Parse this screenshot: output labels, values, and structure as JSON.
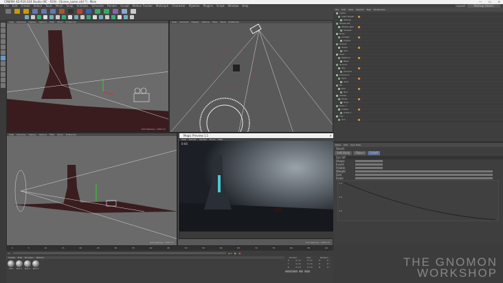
{
  "window": {
    "title": "CINEMA 4D R19.024 Studio (RC - R19) - [Scene_name.c4d *] - Main",
    "layout_label": "Layout:",
    "layout_value": "Startup (User)"
  },
  "menu": [
    "File",
    "Edit",
    "Create",
    "Select",
    "Tools",
    "Mesh",
    "Snap",
    "Animate",
    "Simulate",
    "Render",
    "Sculpt",
    "Motion Tracker",
    "MoGraph",
    "Character",
    "Pipeline",
    "Plugins",
    "Script",
    "Window",
    "Help"
  ],
  "viewports": [
    {
      "name": "Perspective",
      "menu": [
        "View",
        "Cameras",
        "Display",
        "Options",
        "Filter",
        "Panel",
        "ProRender"
      ],
      "footer": "Grid Spacing : 1000 cm"
    },
    {
      "name": "Top",
      "menu": [
        "View",
        "Cameras",
        "Display",
        "Options",
        "Filter",
        "Panel",
        "ProRender"
      ],
      "footer": "Grid Spacing : 1000 cm"
    },
    {
      "name": "Right",
      "menu": [
        "View",
        "Cameras",
        "Display",
        "Options",
        "Filter",
        "Panel",
        "ProRender"
      ],
      "footer": "Grid Spacing : 1000 cm"
    },
    {
      "name": "Front",
      "menu": [
        "View",
        "Cameras",
        "Display",
        "Options",
        "Filter",
        "Panel",
        "ProRender"
      ],
      "footer": "Grid Spacing : 1000 cm"
    }
  ],
  "render_window": {
    "title": "Magic Preview 1.1",
    "menu": [
      "View",
      "Render",
      "Update",
      "Focus",
      "Help"
    ],
    "status": "0:00"
  },
  "object_manager": {
    "menu": [
      "File",
      "Edit",
      "View",
      "Objects",
      "Tags",
      "Bookmarks"
    ],
    "objects": [
      "Lights",
      "Light Target",
      "Vehicle",
      "Wheel left",
      "Wheel right",
      "Chassis",
      "Body",
      "Cockpit",
      "Engine",
      "Rocket",
      "Tower",
      "Arm",
      "Gear",
      "Platform",
      "Base",
      "Ground",
      "Sky",
      "Camera",
      "Camera.1",
      "Spot",
      "Area",
      "Fill",
      "Rim",
      "Null",
      "Cables",
      "Props",
      "Rock",
      "Rock.1",
      "Crates",
      "Crate.1",
      "Fog",
      "Sun"
    ]
  },
  "attribute_manager": {
    "menu": [
      "Mode",
      "Edit",
      "User Data"
    ],
    "object": "Smart",
    "tabs": [
      "Soft Body",
      "Object",
      "Falloff"
    ],
    "section": "Fall Off",
    "fields": [
      "Shape",
      "Invert",
      "Visible",
      "Weight",
      "Size",
      "Scale"
    ],
    "graph_ticks": [
      "1.0",
      "0.8",
      "0.6"
    ]
  },
  "timeline": {
    "start": "0 F",
    "end": "90 F",
    "current": "0 F",
    "ticks": [
      "0",
      "5",
      "10",
      "15",
      "20",
      "25",
      "30",
      "35",
      "40",
      "45",
      "50",
      "55",
      "60",
      "65",
      "70",
      "75",
      "80",
      "85",
      "90"
    ]
  },
  "materials": {
    "menu": [
      "Create",
      "Edit",
      "Function",
      "Texture"
    ],
    "items": [
      "Mat",
      "Mat.1",
      "Mat.2",
      "Mat.3"
    ]
  },
  "coordinates": {
    "headers": [
      "Position",
      "Size",
      "Rotation"
    ],
    "rows": [
      [
        "X",
        "0 cm",
        "0 cm",
        "H",
        "0 °"
      ],
      [
        "Y",
        "0 cm",
        "0 cm",
        "P",
        "0 °"
      ],
      [
        "Z",
        "0 cm",
        "0 cm",
        "B",
        "0 °"
      ]
    ],
    "mode": "Object (Rel)",
    "size_mode": "Size",
    "apply": "Apply"
  },
  "watermark": {
    "line1": "THE GNOMON",
    "line2": "WORKSHOP"
  }
}
